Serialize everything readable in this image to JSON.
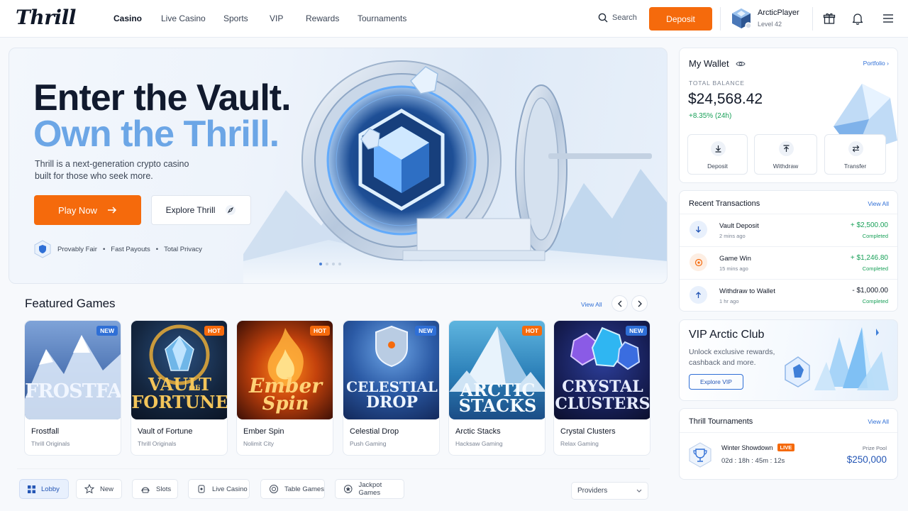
{
  "header": {
    "logo": "Thrill",
    "nav": [
      "Casino",
      "Live Casino",
      "Sports",
      "VIP",
      "Rewards",
      "Tournaments"
    ],
    "search_label": "Search",
    "deposit_label": "Deposit",
    "user": {
      "name": "ArcticPlayer",
      "level": "Level 42"
    }
  },
  "hero": {
    "title_line1": "Enter the Vault.",
    "title_line2": "Own the Thrill.",
    "description": "Thrill is a next-generation crypto casino built for those who seek more.",
    "play_label": "Play Now",
    "explore_label": "Explore Thrill",
    "trust": [
      "Provably Fair",
      "Fast Payouts",
      "Total Privacy"
    ],
    "slide_count": 4,
    "active_slide": 1
  },
  "featured": {
    "title": "Featured Games",
    "view_all": "View All",
    "games": [
      {
        "name": "Frostfall",
        "provider": "Thrill Originals",
        "badge": "NEW",
        "art": [
          "FROSTFALL"
        ]
      },
      {
        "name": "Vault of Fortune",
        "provider": "Thrill Originals",
        "badge": "HOT",
        "art": [
          "VAULT",
          "OF",
          "FORTUNE"
        ]
      },
      {
        "name": "Ember Spin",
        "provider": "Nolimit City",
        "badge": "HOT",
        "art": [
          "Ember",
          "Spin"
        ]
      },
      {
        "name": "Celestial Drop",
        "provider": "Push Gaming",
        "badge": "NEW",
        "art": [
          "CELESTIAL",
          "DROP"
        ]
      },
      {
        "name": "Arctic Stacks",
        "provider": "Hacksaw Gaming",
        "badge": "HOT",
        "art": [
          "ARCTIC",
          "STACKS"
        ]
      },
      {
        "name": "Crystal Clusters",
        "provider": "Relax Gaming",
        "badge": "NEW",
        "art": [
          "CRYSTAL",
          "CLUSTERS"
        ]
      }
    ]
  },
  "tabs": [
    "Lobby",
    "New",
    "Slots",
    "Live Casino",
    "Table Games",
    "Jackpot Games"
  ],
  "providers_label": "Providers",
  "wallet": {
    "title": "My Wallet",
    "portfolio": "Portfolio",
    "balance_label": "TOTAL BALANCE",
    "balance": "$24,568.42",
    "change": "+8.35% (24h)",
    "actions": [
      "Deposit",
      "Withdraw",
      "Transfer"
    ]
  },
  "transactions": {
    "title": "Recent Transactions",
    "view_all": "View All",
    "items": [
      {
        "name": "Vault Deposit",
        "time": "2 mins ago",
        "amount": "+ $2,500.00",
        "status": "Completed"
      },
      {
        "name": "Game Win",
        "time": "15 mins ago",
        "amount": "+ $1,246.80",
        "status": "Completed"
      },
      {
        "name": "Withdraw to Wallet",
        "time": "1 hr ago",
        "amount": "- $1,000.00",
        "status": "Completed"
      }
    ]
  },
  "vip": {
    "title": "VIP Arctic Club",
    "description": "Unlock exclusive rewards, cashback and more.",
    "button": "Explore VIP"
  },
  "tournaments": {
    "title": "Thrill Tournaments",
    "view_all": "View All",
    "event": "Winter Showdown",
    "live": "LIVE",
    "timer": "02d : 18h : 45m : 12s",
    "prize_label": "Prize Pool",
    "prize": "$250,000"
  },
  "colors": {
    "accent": "#f56a0c",
    "link": "#2f6fd6",
    "positive": "#18a058",
    "negative": "#111827"
  }
}
